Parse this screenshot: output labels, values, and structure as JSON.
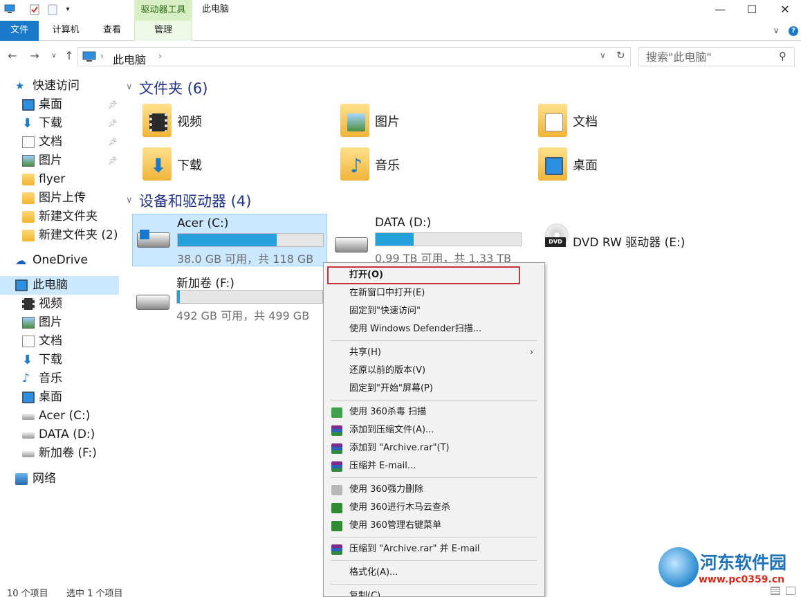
{
  "window": {
    "title": "此电脑",
    "context_tab_head": "驱动器工具",
    "minimize_glyph": "—",
    "maximize_glyph": "☐",
    "close_glyph": "✕"
  },
  "ribbon": {
    "tabs": [
      {
        "label": "文件"
      },
      {
        "label": "计算机"
      },
      {
        "label": "查看"
      },
      {
        "label": "管理"
      }
    ],
    "expand_glyph": "∨",
    "help_glyph": "?"
  },
  "address": {
    "path": "此电脑",
    "search_placeholder": "搜索\"此电脑\""
  },
  "sidebar": {
    "quick_access": "快速访问",
    "quick_items": [
      {
        "label": "桌面",
        "pinned": true
      },
      {
        "label": "下载",
        "pinned": true
      },
      {
        "label": "文档",
        "pinned": true
      },
      {
        "label": "图片",
        "pinned": true
      },
      {
        "label": "flyer"
      },
      {
        "label": "图片上传"
      },
      {
        "label": "新建文件夹"
      },
      {
        "label": "新建文件夹 (2)"
      }
    ],
    "onedrive": "OneDrive",
    "this_pc": "此电脑",
    "pc_items": [
      {
        "label": "视频"
      },
      {
        "label": "图片"
      },
      {
        "label": "文档"
      },
      {
        "label": "下载"
      },
      {
        "label": "音乐"
      },
      {
        "label": "桌面"
      },
      {
        "label": "Acer (C:)"
      },
      {
        "label": "DATA (D:)"
      },
      {
        "label": "新加卷 (F:)"
      }
    ],
    "network": "网络"
  },
  "main": {
    "folders_header": "文件夹 (6)",
    "folders": [
      {
        "name": "视频"
      },
      {
        "name": "图片"
      },
      {
        "name": "文档"
      },
      {
        "name": "下载"
      },
      {
        "name": "音乐"
      },
      {
        "name": "桌面"
      }
    ],
    "devices_header": "设备和驱动器 (4)",
    "drives": [
      {
        "name": "Acer (C:)",
        "info": "38.0 GB 可用，共 118 GB",
        "used_fraction": 0.68
      },
      {
        "name": "DATA (D:)",
        "info": "0.99 TB 可用，共 1.33 TB",
        "used_fraction": 0.26
      },
      {
        "name": "新加卷 (F:)",
        "info": "492 GB 可用，共 499 GB",
        "used_fraction": 0.02
      },
      {
        "name": "DVD RW 驱动器 (E:)"
      }
    ]
  },
  "context_menu": {
    "items": [
      "打开(O)",
      "在新窗口中打开(E)",
      "固定到\"快速访问\"",
      "使用 Windows Defender扫描...",
      "共享(H)",
      "还原以前的版本(V)",
      "固定到\"开始\"屏幕(P)",
      "使用 360杀毒 扫描",
      "添加到压缩文件(A)...",
      "添加到 \"Archive.rar\"(T)",
      "压缩并 E-mail...",
      "使用 360强力删除",
      "使用 360进行木马云查杀",
      "使用 360管理右键菜单",
      "压缩到 \"Archive.rar\" 并 E-mail",
      "格式化(A)...",
      "复制(C)"
    ]
  },
  "status": {
    "item_count": "10 个项目",
    "selected": "选中 1 个项目"
  },
  "watermark": {
    "title": "河东软件园",
    "url": "www.pc0359.cn"
  }
}
